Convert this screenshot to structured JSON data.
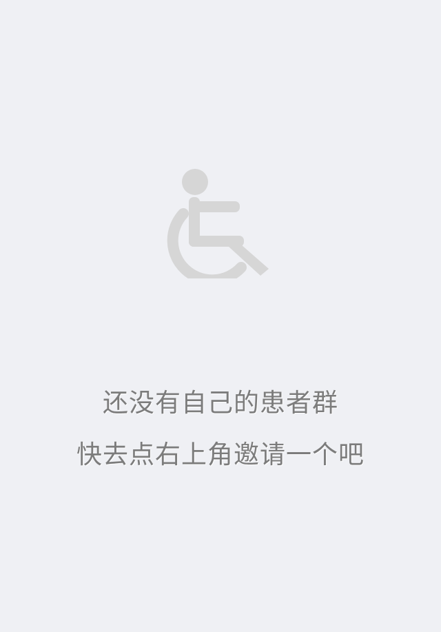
{
  "empty_state": {
    "icon": "wheelchair-icon",
    "icon_color": "#d6d6d6",
    "text_color": "#7c7c7c",
    "background_color": "#eff0f4",
    "line1": "还没有自己的患者群",
    "line2": "快去点右上角邀请一个吧"
  }
}
